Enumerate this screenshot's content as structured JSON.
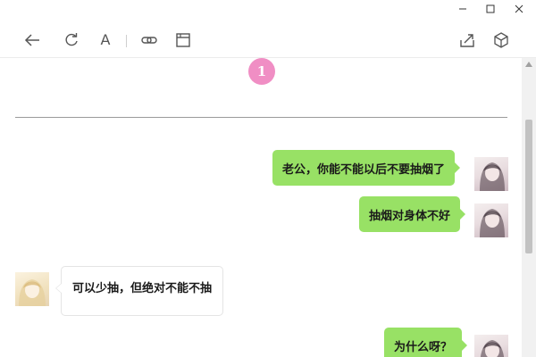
{
  "window": {
    "controls": [
      "minimize-icon",
      "maximize-icon",
      "close-icon"
    ]
  },
  "toolbar": {
    "left_icons": [
      "back-arrow-icon",
      "refresh-icon",
      "font-icon",
      "link-icon",
      "window-icon"
    ],
    "font_label": "A",
    "right_icons": [
      "share-icon",
      "cube-icon"
    ]
  },
  "content": {
    "page_badge": "1",
    "messages": [
      {
        "side": "right",
        "text": "老公，你能不能以后不要抽烟了"
      },
      {
        "side": "right",
        "text": "抽烟对身体不好"
      },
      {
        "side": "left",
        "text": "可以少抽，但绝对不能不抽"
      },
      {
        "side": "right",
        "text": "为什么呀？"
      }
    ]
  },
  "colors": {
    "sent_bubble": "#98e165",
    "received_bubble": "#ffffff",
    "badge": "#f08ec4",
    "scroll_thumb": "#c2c2c2"
  }
}
